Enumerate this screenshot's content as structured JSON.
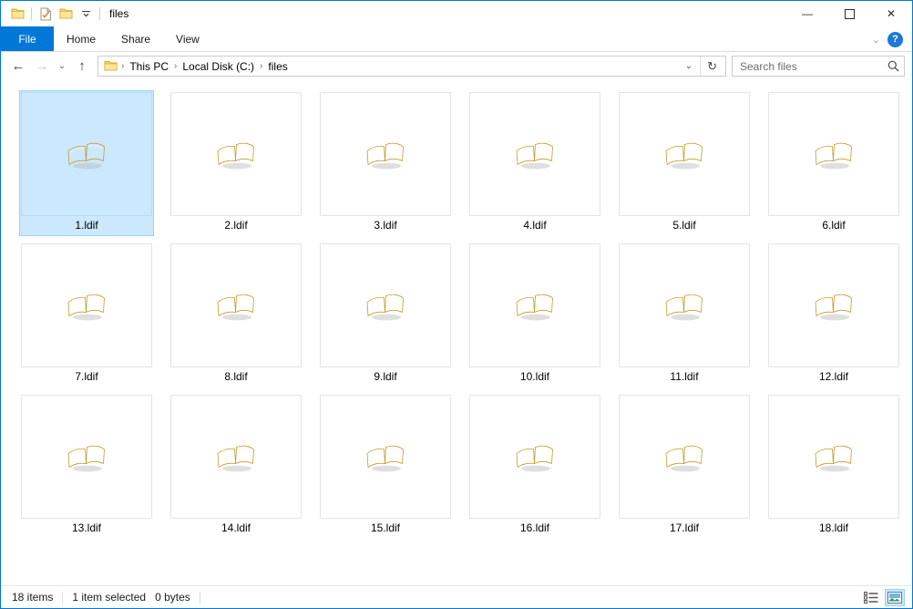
{
  "window": {
    "title": "files",
    "quick_access": [
      {
        "name": "folder-icon",
        "label": "Folder"
      },
      {
        "name": "properties-icon",
        "label": "Properties"
      },
      {
        "name": "new-folder-icon",
        "label": "New folder"
      },
      {
        "name": "chevron-down-icon",
        "label": "Customize Quick Access Toolbar"
      }
    ],
    "controls": {
      "minimize": "—",
      "maximize": "☐",
      "close": "✕"
    }
  },
  "ribbon": {
    "tabs": [
      {
        "label": "File",
        "active": true
      },
      {
        "label": "Home",
        "active": false
      },
      {
        "label": "Share",
        "active": false
      },
      {
        "label": "View",
        "active": false
      }
    ],
    "collapse_label": "⌄",
    "help_label": "?"
  },
  "address": {
    "back_label": "←",
    "forward_label": "→",
    "recent_label": "⌄",
    "up_label": "↑",
    "breadcrumbs": [
      "This PC",
      "Local Disk (C:)",
      "files"
    ],
    "separator": "›",
    "dropdown_label": "⌄",
    "refresh_label": "↻"
  },
  "search": {
    "placeholder": "Search files",
    "value": "",
    "icon": "search-icon"
  },
  "files": [
    {
      "name": "1.ldif",
      "icon": "book-icon",
      "selected": true
    },
    {
      "name": "2.ldif",
      "icon": "book-icon",
      "selected": false
    },
    {
      "name": "3.ldif",
      "icon": "book-icon",
      "selected": false
    },
    {
      "name": "4.ldif",
      "icon": "book-icon",
      "selected": false
    },
    {
      "name": "5.ldif",
      "icon": "book-icon",
      "selected": false
    },
    {
      "name": "6.ldif",
      "icon": "book-icon",
      "selected": false
    },
    {
      "name": "7.ldif",
      "icon": "book-icon",
      "selected": false
    },
    {
      "name": "8.ldif",
      "icon": "book-icon",
      "selected": false
    },
    {
      "name": "9.ldif",
      "icon": "book-icon",
      "selected": false
    },
    {
      "name": "10.ldif",
      "icon": "book-icon",
      "selected": false
    },
    {
      "name": "11.ldif",
      "icon": "book-icon",
      "selected": false
    },
    {
      "name": "12.ldif",
      "icon": "book-icon",
      "selected": false
    },
    {
      "name": "13.ldif",
      "icon": "book-icon",
      "selected": false
    },
    {
      "name": "14.ldif",
      "icon": "book-icon",
      "selected": false
    },
    {
      "name": "15.ldif",
      "icon": "book-icon",
      "selected": false
    },
    {
      "name": "16.ldif",
      "icon": "book-icon",
      "selected": false
    },
    {
      "name": "17.ldif",
      "icon": "book-icon",
      "selected": false
    },
    {
      "name": "18.ldif",
      "icon": "book-icon",
      "selected": false
    }
  ],
  "status": {
    "item_count": "18 items",
    "selection": "1 item selected",
    "size": "0 bytes",
    "views": [
      {
        "name": "details-view-button",
        "active": false
      },
      {
        "name": "large-icons-view-button",
        "active": true
      }
    ]
  },
  "colors": {
    "accent": "#0078d7",
    "selection_bg": "#cce8ff",
    "selection_border": "#99d1ff",
    "tile_border": "#e4e4e4",
    "icon_gold": "#e8c75a"
  }
}
